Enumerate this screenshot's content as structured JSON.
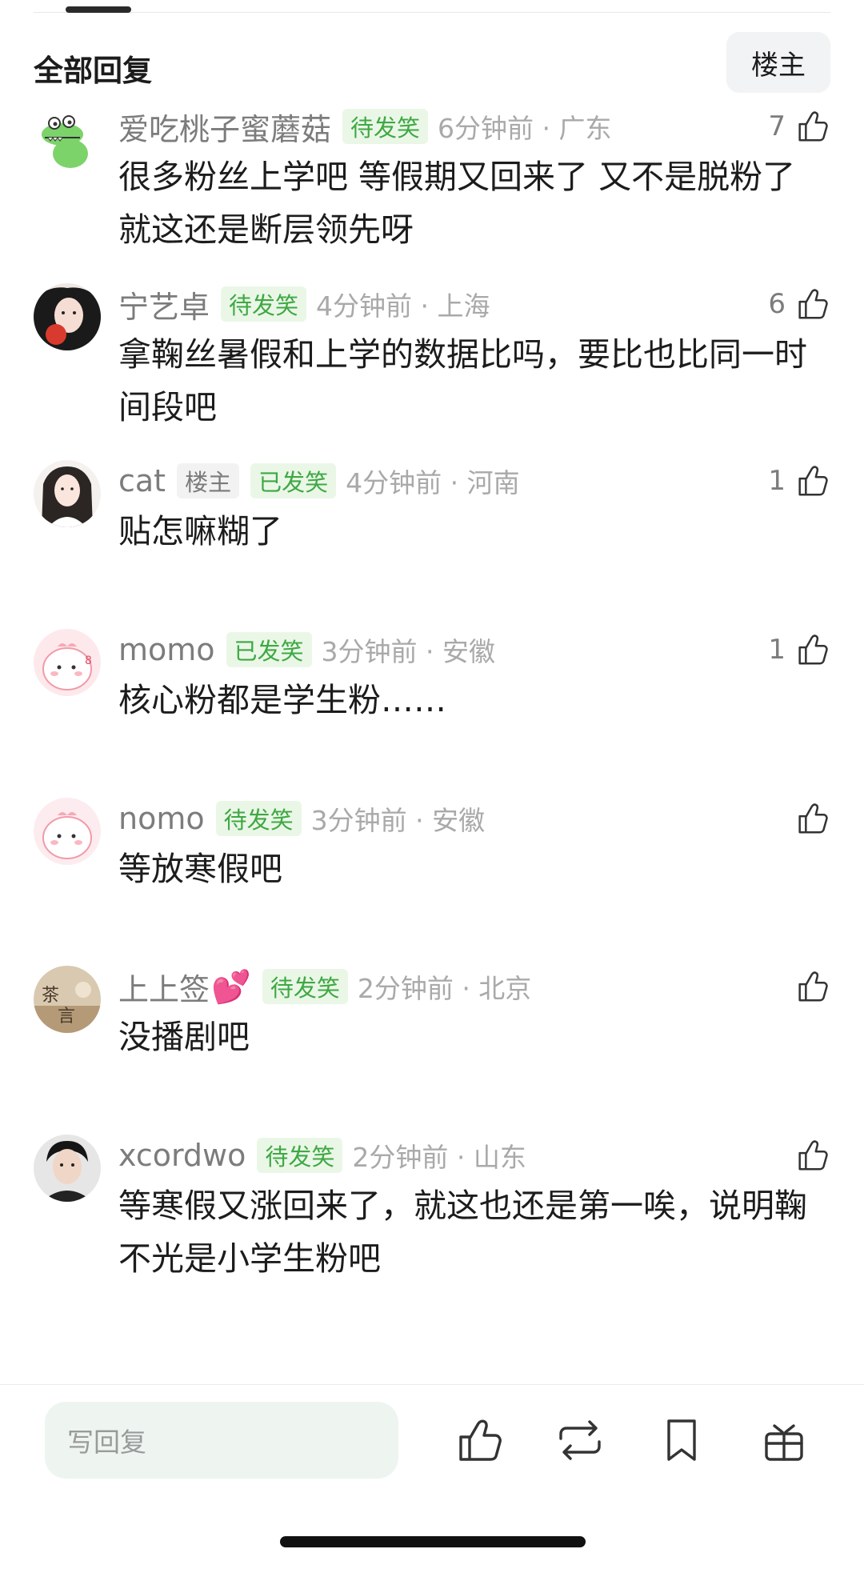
{
  "header": {
    "title": "全部回复",
    "owner_filter": "楼主"
  },
  "comments": [
    {
      "username": "爱吃桃子蜜蘑菇",
      "badges": [
        {
          "text": "待发笑"
        }
      ],
      "time_location": "6分钟前 · 广东",
      "likes": "7",
      "content": "很多粉丝上学吧 等假期又回来了 又不是脱粉了 就这还是断层领先呀"
    },
    {
      "username": "宁艺卓",
      "badges": [
        {
          "text": "待发笑"
        }
      ],
      "time_location": "4分钟前 · 上海",
      "likes": "6",
      "content": "拿鞠丝暑假和上学的数据比吗，要比也比同一时间段吧"
    },
    {
      "username": "cat",
      "badges": [
        {
          "text": "楼主"
        },
        {
          "text": "已发笑"
        }
      ],
      "time_location": "4分钟前 · 河南",
      "likes": "1",
      "content": "贴怎嘛糊了"
    },
    {
      "username": "momo",
      "badges": [
        {
          "text": "已发笑"
        }
      ],
      "time_location": "3分钟前 · 安徽",
      "likes": "1",
      "content": "核心粉都是学生粉……"
    },
    {
      "username": "nomo",
      "badges": [
        {
          "text": "待发笑"
        }
      ],
      "time_location": "3分钟前 · 安徽",
      "likes": "",
      "content": "等放寒假吧"
    },
    {
      "username": "上上签",
      "username_emoji": "💕",
      "badges": [
        {
          "text": "待发笑"
        }
      ],
      "time_location": "2分钟前 · 北京",
      "likes": "",
      "content": "没播剧吧"
    },
    {
      "username": "xcordwo",
      "badges": [
        {
          "text": "待发笑"
        }
      ],
      "time_location": "2分钟前 · 山东",
      "likes": "",
      "content": "等寒假又涨回来了，就这也还是第一唉，说明鞠不光是小学生粉吧"
    }
  ],
  "bottom_bar": {
    "reply_placeholder": "写回复",
    "actions": [
      "thumbs-up-icon",
      "repost-icon",
      "bookmark-icon",
      "gift-icon"
    ]
  },
  "colors": {
    "badge_green_text": "#3fa844",
    "badge_green_bg": "#eaf7e7",
    "meta_gray": "#a9a9a9"
  }
}
